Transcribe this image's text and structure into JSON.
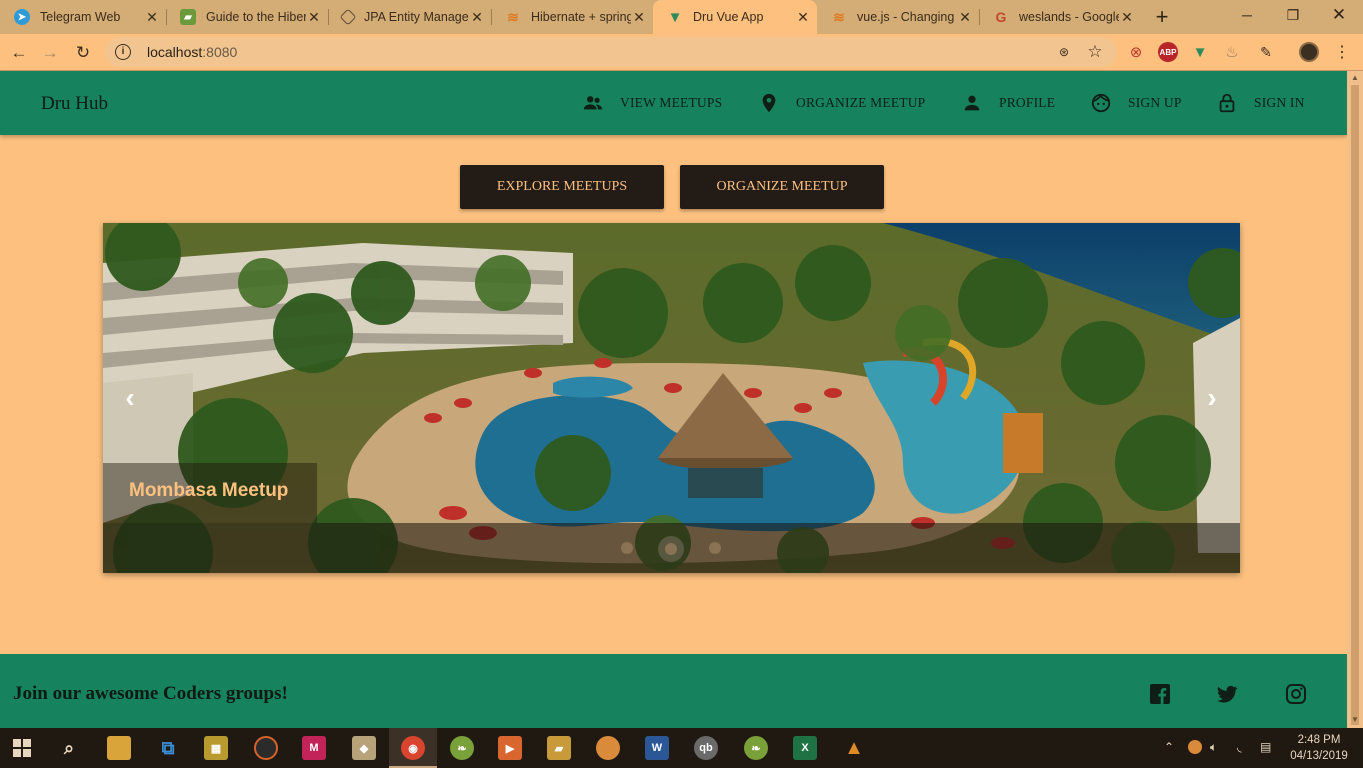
{
  "browser": {
    "tabs": [
      {
        "title": "Telegram Web",
        "favicon": "telegram-icon",
        "color": "#2f9bd6"
      },
      {
        "title": "Guide to the Hiber",
        "favicon": "baeldung-icon",
        "color": "#6a9a3a"
      },
      {
        "title": "JPA Entity Manage",
        "favicon": "jpa-icon",
        "color": "#7a6a55"
      },
      {
        "title": "Hibernate + spring",
        "favicon": "stackoverflow-icon",
        "color": "#e07a24"
      },
      {
        "title": "Dru Vue App",
        "favicon": "vue-icon",
        "color": "#2d8a5a"
      },
      {
        "title": "vue.js - Changing",
        "favicon": "stackoverflow-icon",
        "color": "#e07a24"
      },
      {
        "title": "weslands - Google",
        "favicon": "google-icon",
        "color": "#c2492e"
      }
    ],
    "active_tab_index": 4,
    "url": "localhost",
    "url_port": ":8080"
  },
  "app": {
    "brand": "Dru Hub",
    "nav": [
      {
        "label": "VIEW MEETUPS",
        "icon": "people-icon"
      },
      {
        "label": "ORGANIZE MEETUP",
        "icon": "location-pin-icon"
      },
      {
        "label": "PROFILE",
        "icon": "person-icon"
      },
      {
        "label": "SIGN UP",
        "icon": "face-icon"
      },
      {
        "label": "SIGN IN",
        "icon": "lock-icon"
      }
    ],
    "buttons": {
      "explore": "EXPLORE MEETUPS",
      "organize": "ORGANIZE MEETUP"
    },
    "carousel": {
      "caption": "Mombasa Meetup",
      "slide_count": 3,
      "active_slide": 2
    },
    "footer": {
      "tagline": "Join our awesome Coders groups!",
      "social": [
        "facebook-icon",
        "twitter-icon",
        "instagram-icon"
      ]
    },
    "colors": {
      "primary": "#16825e",
      "background": "#fdc07f",
      "button_dark": "#231c16",
      "button_text": "#fdc07f"
    }
  },
  "taskbar": {
    "time": "2:48 PM",
    "date": "04/13/2019"
  }
}
